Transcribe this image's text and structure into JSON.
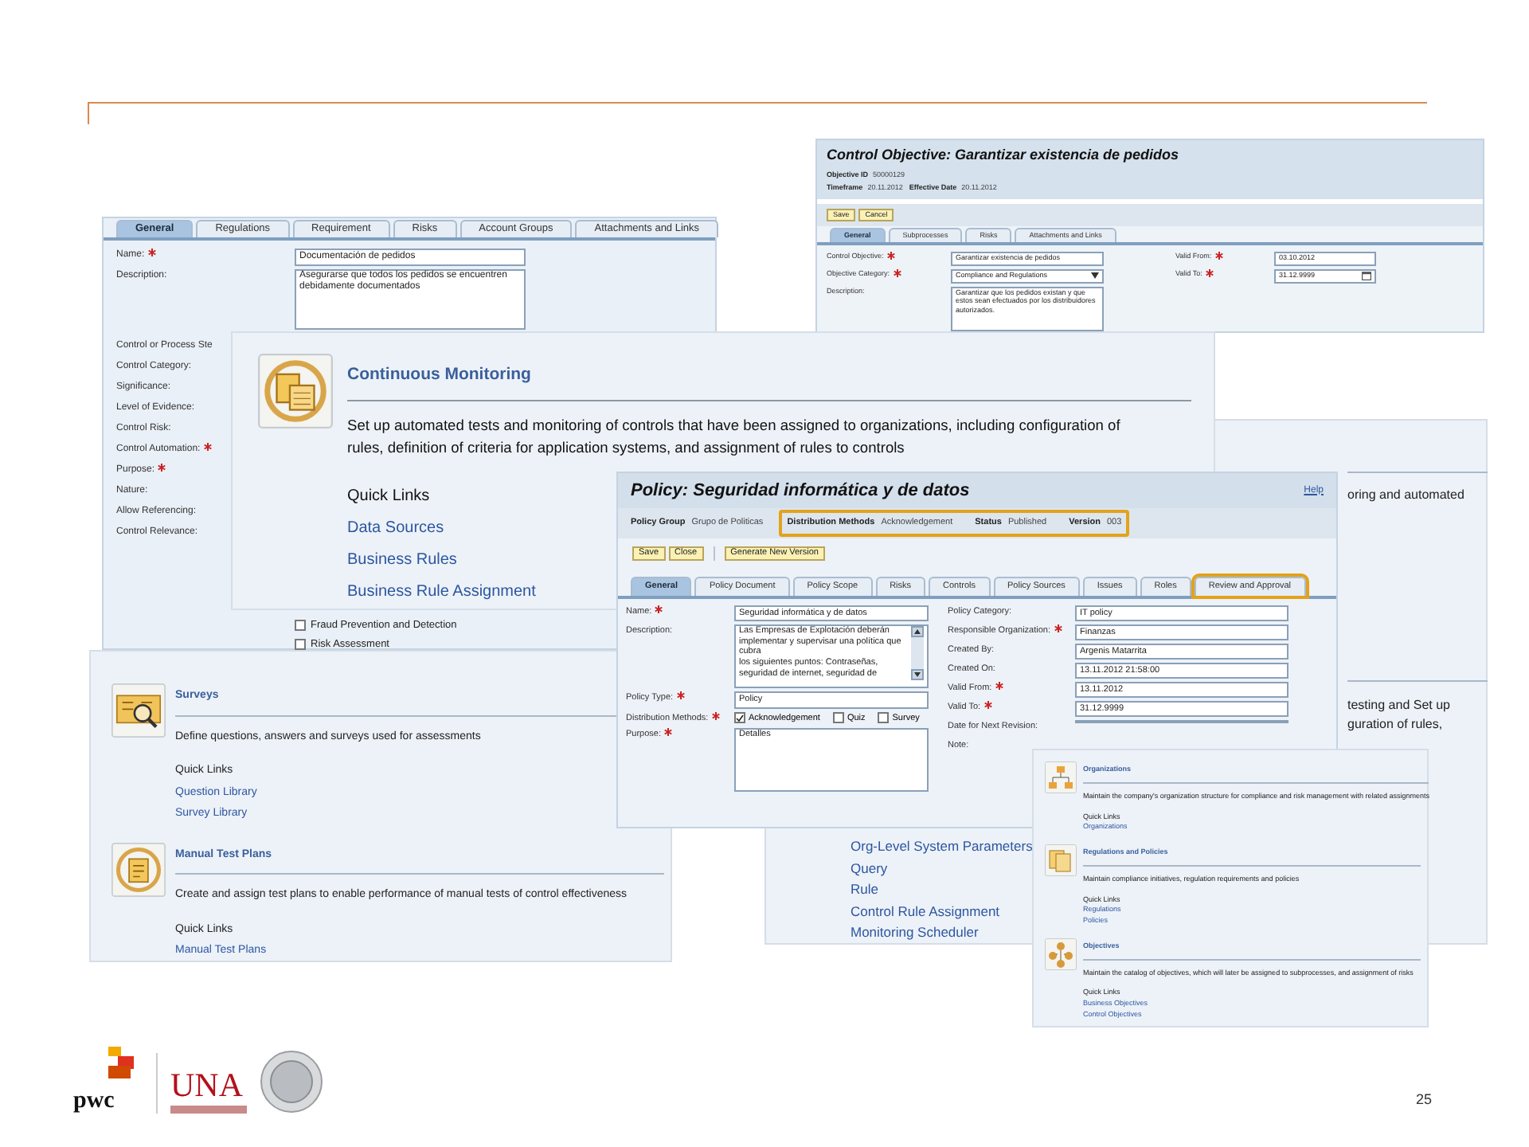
{
  "control_objective_window": {
    "title": "Control Objective: Garantizar existencia de pedidos",
    "info_rows": [
      [
        {
          "label": "Objective ID",
          "value": "50000129"
        }
      ],
      [
        {
          "label": "Timeframe",
          "value": "20.11.2012"
        },
        {
          "label": "Effective Date",
          "value": "20.11.2012"
        }
      ]
    ],
    "buttons": [
      "Save",
      "Cancel"
    ],
    "tabs": [
      {
        "label": "General",
        "selected": true
      },
      {
        "label": "Subprocesses",
        "selected": false
      },
      {
        "label": "Risks",
        "selected": false
      },
      {
        "label": "Attachments and Links",
        "selected": false
      }
    ],
    "left_fields": [
      {
        "label": "Control Objective:",
        "required": true,
        "kind": "text",
        "value": "Garantizar existencia de pedidos"
      },
      {
        "label": "Objective Category:",
        "required": true,
        "kind": "select",
        "value": "Compliance and Regulations"
      },
      {
        "label": "Description:",
        "required": false,
        "kind": "textarea",
        "value": "Garantizar que los pedidos existan y que estos sean efectuados por los distribuidores autorizados."
      }
    ],
    "right_fields": [
      {
        "label": "Valid From:",
        "required": true,
        "kind": "text",
        "value": "03.10.2012"
      },
      {
        "label": "Valid To:",
        "required": true,
        "kind": "date",
        "value": "31.12.9999"
      }
    ]
  },
  "control_window": {
    "tabs": [
      {
        "label": "General",
        "selected": true
      },
      {
        "label": "Regulations",
        "selected": false
      },
      {
        "label": "Requirement",
        "selected": false
      },
      {
        "label": "Risks",
        "selected": false
      },
      {
        "label": "Account Groups",
        "selected": false
      },
      {
        "label": "Attachments and Links",
        "selected": false
      }
    ],
    "fields": [
      {
        "label": "Name:",
        "required": true,
        "kind": "text",
        "value": "Documentación de pedidos"
      },
      {
        "label": "Description:",
        "required": false,
        "kind": "textarea",
        "value": "Asegurarse que todos los pedidos se encuentren debidamente documentados"
      },
      {
        "label": "Control or Process Ste",
        "required": false,
        "kind": "label"
      },
      {
        "label": "Control Category:",
        "required": false,
        "kind": "label"
      },
      {
        "label": "Significance:",
        "required": false,
        "kind": "label"
      },
      {
        "label": "Level of Evidence:",
        "required": false,
        "kind": "label"
      },
      {
        "label": "Control Risk:",
        "required": false,
        "kind": "label"
      },
      {
        "label": "Control Automation:",
        "required": true,
        "kind": "label"
      },
      {
        "label": "Purpose:",
        "required": true,
        "kind": "label"
      },
      {
        "label": "Nature:",
        "required": false,
        "kind": "label"
      },
      {
        "label": "Allow Referencing:",
        "required": false,
        "kind": "label"
      },
      {
        "label": "Control Relevance:",
        "required": false,
        "kind": "label"
      }
    ],
    "checkboxes": [
      {
        "label": "Fraud Prevention and Detection",
        "checked": false
      },
      {
        "label": "Risk Assessment",
        "checked": false
      }
    ]
  },
  "right_panel": {
    "fragments": [
      "oring and automated",
      "testing and Set up",
      "guration of rules,"
    ],
    "links": [
      "Org-Level System Parameters",
      "Query",
      "Rule",
      "Control Rule Assignment",
      "Monitoring Scheduler"
    ]
  },
  "monitoring_panel": {
    "title": "Continuous Monitoring",
    "description": "Set up automated tests and monitoring of controls that have been assigned to organizations, including configuration of rules, definition of criteria for application systems, and assignment of rules to controls",
    "quick_links_label": "Quick Links",
    "links": [
      "Data Sources",
      "Business Rules",
      "Business Rule Assignment"
    ]
  },
  "surveys_panel": {
    "sections": [
      {
        "title": "Surveys",
        "description": "Define questions, answers and surveys used for assessments",
        "quick_links_label": "Quick Links",
        "links": [
          "Question Library",
          "Survey Library"
        ]
      },
      {
        "title": "Manual Test Plans",
        "description": "Create and assign test plans to enable performance of manual tests of control effectiveness",
        "quick_links_label": "Quick Links",
        "links": [
          "Manual Test Plans"
        ]
      }
    ]
  },
  "policy_window": {
    "title": "Policy: Seguridad informática y de datos",
    "help": "Help",
    "info": [
      {
        "label": "Policy Group",
        "value": "Grupo de Politicas",
        "highlighted": false
      },
      {
        "label": "Distribution Methods",
        "value": "Acknowledgement",
        "highlighted": true
      },
      {
        "label": "Status",
        "value": "Published",
        "highlighted": true
      },
      {
        "label": "Version",
        "value": "003",
        "highlighted": true
      }
    ],
    "buttons": [
      "Save",
      "Close"
    ],
    "extra_button": "Generate New Version",
    "tabs": [
      {
        "label": "General",
        "selected": true,
        "highlighted": false
      },
      {
        "label": "Policy Document",
        "selected": false,
        "highlighted": false
      },
      {
        "label": "Policy Scope",
        "selected": false,
        "highlighted": false
      },
      {
        "label": "Risks",
        "selected": false,
        "highlighted": false
      },
      {
        "label": "Controls",
        "selected": false,
        "highlighted": false
      },
      {
        "label": "Policy Sources",
        "selected": false,
        "highlighted": false
      },
      {
        "label": "Issues",
        "selected": false,
        "highlighted": false
      },
      {
        "label": "Roles",
        "selected": false,
        "highlighted": false
      },
      {
        "label": "Review and Approval",
        "selected": false,
        "highlighted": true
      }
    ],
    "left_fields": [
      {
        "label": "Name:",
        "required": true,
        "kind": "text",
        "value": "Seguridad informática y de datos"
      },
      {
        "label": "Description:",
        "required": false,
        "kind": "scrolltext",
        "value": "Las Empresas de Explotación deberán implementar y supervisar una política que cubra\nlos siguientes puntos: Contraseñas, seguridad de internet, seguridad de"
      },
      {
        "label": "Policy Type:",
        "required": true,
        "kind": "text",
        "value": "Policy"
      },
      {
        "label": "Distribution Methods:",
        "required": true,
        "kind": "checks",
        "options": [
          {
            "label": "Acknowledgement",
            "checked": true
          },
          {
            "label": "Quiz",
            "checked": false
          },
          {
            "label": "Survey",
            "checked": false
          }
        ]
      },
      {
        "label": "Purpose:",
        "required": true,
        "kind": "textarea",
        "value": "Detalles"
      }
    ],
    "right_fields": [
      {
        "label": "Policy Category:",
        "required": false,
        "kind": "text",
        "value": "IT policy"
      },
      {
        "label": "Responsible Organization:",
        "required": true,
        "kind": "text",
        "value": "Finanzas"
      },
      {
        "label": "Created By:",
        "required": false,
        "kind": "text",
        "value": "Argenis Matarrita"
      },
      {
        "label": "Created On:",
        "required": false,
        "kind": "text",
        "value": "13.11.2012 21:58:00"
      },
      {
        "label": "Valid From:",
        "required": true,
        "kind": "text",
        "value": "13.11.2012"
      },
      {
        "label": "Valid To:",
        "required": true,
        "kind": "text",
        "value": "31.12.9999"
      },
      {
        "label": "Date for Next Revision:",
        "required": false,
        "kind": "text"
      },
      {
        "label": "Note:",
        "required": false,
        "kind": "label"
      }
    ]
  },
  "overview_panel": {
    "sections": [
      {
        "title": "Organizations",
        "description": "Maintain the company's organization structure for compliance and risk management with related assignments",
        "quick_links_label": "Quick Links",
        "links": [
          "Organizations"
        ]
      },
      {
        "title": "Regulations and Policies",
        "description": "Maintain compliance initiatives, regulation requirements and policies",
        "quick_links_label": "Quick Links",
        "links": [
          "Regulations",
          "Policies"
        ]
      },
      {
        "title": "Objectives",
        "description": "Maintain the catalog of objectives, which will later be assigned to subprocesses, and assignment of risks",
        "quick_links_label": "Quick Links",
        "links": [
          "Business Objectives",
          "Control Objectives"
        ]
      }
    ]
  },
  "footer": {
    "pwc_logo": "pwc",
    "una_logo": "UNA",
    "page_number": "25"
  }
}
